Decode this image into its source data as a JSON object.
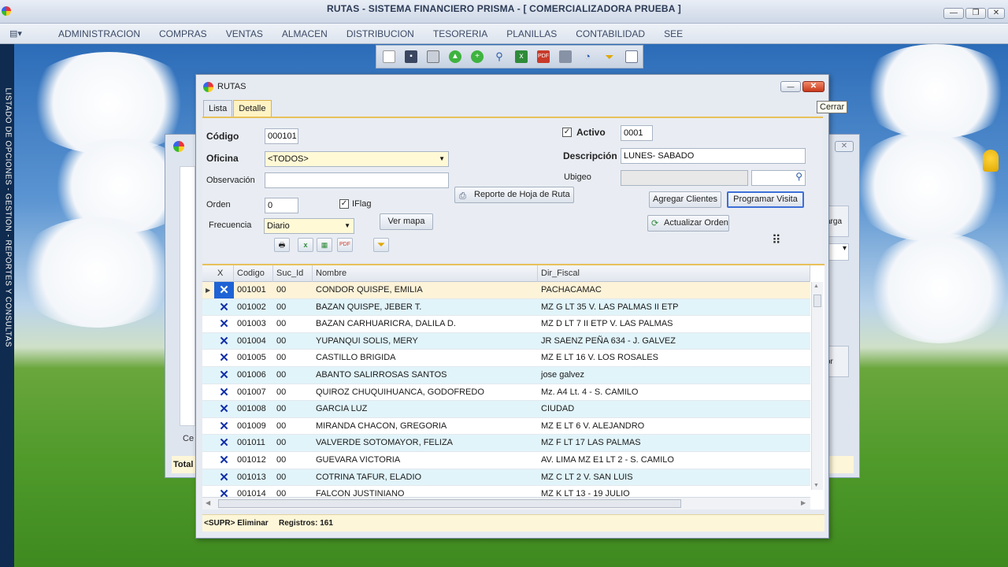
{
  "app": {
    "title": "RUTAS - SISTEMA FINANCIERO PRISMA - [ COMERCIALIZADORA PRUEBA ]"
  },
  "menu": [
    "ADMINISTRACION",
    "COMPRAS",
    "VENTAS",
    "ALMACEN",
    "DISTRIBUCION",
    "TESORERIA",
    "PLANILLAS",
    "CONTABILIDAD",
    "SEE"
  ],
  "sidebar": {
    "text": "LISTADO DE OPCIONES - GESTION - REPORTES Y CONSULTAS"
  },
  "bg_window": {
    "fragments": [
      "arga",
      "or",
      "Ce",
      "Total I"
    ]
  },
  "dialog": {
    "title": "RUTAS",
    "close_tooltip": "Cerrar",
    "tabs": [
      "Lista",
      "Detalle"
    ],
    "active_tab": "Detalle",
    "form": {
      "codigo_label": "Código",
      "codigo_value": "000101",
      "oficina_label": "Oficina",
      "oficina_value": "<TODOS>",
      "observacion_label": "Observación",
      "observacion_value": "",
      "orden_label": "Orden",
      "orden_value": "0",
      "iflag_label": "IFlag",
      "iflag_checked": true,
      "frecuencia_label": "Frecuencia",
      "frecuencia_value": "Diario",
      "ver_mapa_label": "Ver mapa",
      "activo_label": "Activo",
      "activo_checked": true,
      "activo_code": "0001",
      "descripcion_label": "Descripción",
      "descripcion_value": "LUNES- SABADO",
      "ubigeo_label": "Ubigeo",
      "ubigeo_value": "",
      "reporte_label": "Reporte de Hoja de Ruta",
      "agregar_label": "Agregar Clientes",
      "programar_label": "Programar Visita",
      "actualizar_label": "Actualizar Orden"
    },
    "grid": {
      "headers": [
        "X",
        "Codigo",
        "Suc_Id",
        "Nombre",
        "Dir_Fiscal"
      ],
      "rows": [
        {
          "codigo": "001001",
          "suc": "00",
          "nombre": "CONDOR QUISPE, EMILIA",
          "dir": "PACHACAMAC"
        },
        {
          "codigo": "001002",
          "suc": "00",
          "nombre": "BAZAN QUISPE, JEBER T.",
          "dir": "MZ G LT 35 V. LAS PALMAS II ETP"
        },
        {
          "codigo": "001003",
          "suc": "00",
          "nombre": "BAZAN CARHUARICRA, DALILA D.",
          "dir": "MZ D LT 7 II ETP V. LAS PALMAS"
        },
        {
          "codigo": "001004",
          "suc": "00",
          "nombre": "YUPANQUI SOLIS, MERY",
          "dir": "JR SAENZ PEÑA 634 - J. GALVEZ"
        },
        {
          "codigo": "001005",
          "suc": "00",
          "nombre": "CASTILLO BRIGIDA",
          "dir": "MZ E  LT 16 V. LOS ROSALES"
        },
        {
          "codigo": "001006",
          "suc": "00",
          "nombre": "ABANTO SALIRROSAS SANTOS",
          "dir": "jose galvez"
        },
        {
          "codigo": "001007",
          "suc": "00",
          "nombre": "QUIROZ CHUQUIHUANCA, GODOFREDO",
          "dir": "Mz. A4  Lt. 4 - S. CAMILO"
        },
        {
          "codigo": "001008",
          "suc": "00",
          "nombre": "GARCIA LUZ",
          "dir": "CIUDAD"
        },
        {
          "codigo": "001009",
          "suc": "00",
          "nombre": "MIRANDA CHACON, GREGORIA",
          "dir": "MZ E LT 6 V. ALEJANDRO"
        },
        {
          "codigo": "001011",
          "suc": "00",
          "nombre": "VALVERDE SOTOMAYOR, FELIZA",
          "dir": "MZ F LT 17 LAS PALMAS"
        },
        {
          "codigo": "001012",
          "suc": "00",
          "nombre": "GUEVARA VICTORIA",
          "dir": "AV. LIMA MZ E1 LT 2 - S. CAMILO"
        },
        {
          "codigo": "001013",
          "suc": "00",
          "nombre": "COTRINA TAFUR, ELADIO",
          "dir": "MZ C LT 2 V. SAN LUIS"
        },
        {
          "codigo": "001014",
          "suc": "00",
          "nombre": "FALCON JUSTINIANO",
          "dir": "MZ K LT 13 - 19 JULIO"
        }
      ]
    },
    "status": {
      "shortcut": "<SUPR> Eliminar",
      "registros": "Registros: 161"
    }
  },
  "colors": {
    "row_alt": "#e1f4fa",
    "row_selected": "#fdf3d8",
    "accent_bar": "#e8c15a",
    "x_mark": "#1230a8"
  }
}
